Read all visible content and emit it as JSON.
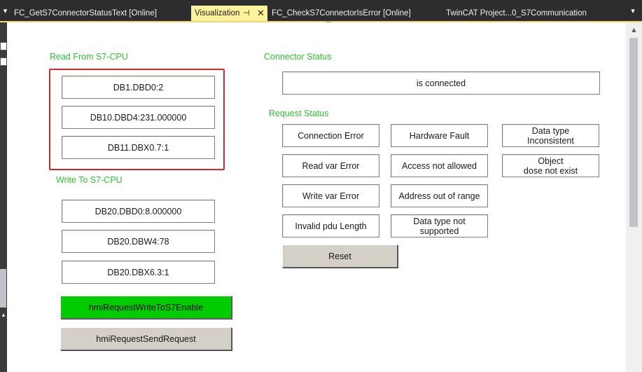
{
  "tabs": {
    "tab1": "FC_GetS7ConnectorStatusText [Online]",
    "active": "Visualization",
    "pin_glyph": "⊣",
    "close_glyph": "✕",
    "tab3": "FC_CheckS7ConnectorIsError [Online]",
    "tab4": "TwinCAT Project...0_S7Communication"
  },
  "read_section": {
    "heading": "Read From S7-CPU",
    "values": [
      "DB1.DBD0:2",
      "DB10.DBD4:231.000000",
      "DB11.DBX0.7:1"
    ]
  },
  "write_section": {
    "heading": "Write To S7-CPU",
    "values": [
      "DB20.DBD0:8.000000",
      "DB20.DBW4:78",
      "DB20.DBX6.3:1"
    ],
    "enable_button": "hmiRequestWriteToS7Enable",
    "send_button": "hmiRequestSendRequest"
  },
  "connector_status": {
    "heading": "Connector Status",
    "value": "is connected"
  },
  "request_status": {
    "heading": "Request Status",
    "col1": [
      "Connection Error",
      "Read var Error",
      "Write var Error",
      "Invalid pdu Length"
    ],
    "col2": [
      "Hardware Fault",
      "Access not allowed",
      "Address out of range",
      "Data type not\nsupported"
    ],
    "col3": [
      "Data type\nInconsistent",
      "Object\ndose not exist"
    ],
    "reset_button": "Reset"
  },
  "colors": {
    "heading_green": "#2fbf2f",
    "active_tab": "#fff29d",
    "highlight_frame": "#d9252b",
    "enable_button": "#00cc00",
    "button_grey": "#d4d0c8"
  },
  "icons": {
    "tab_dropdown": "▾",
    "tabs_menu": "▾",
    "scroll_up": "▲",
    "left_arrow": "▴"
  }
}
